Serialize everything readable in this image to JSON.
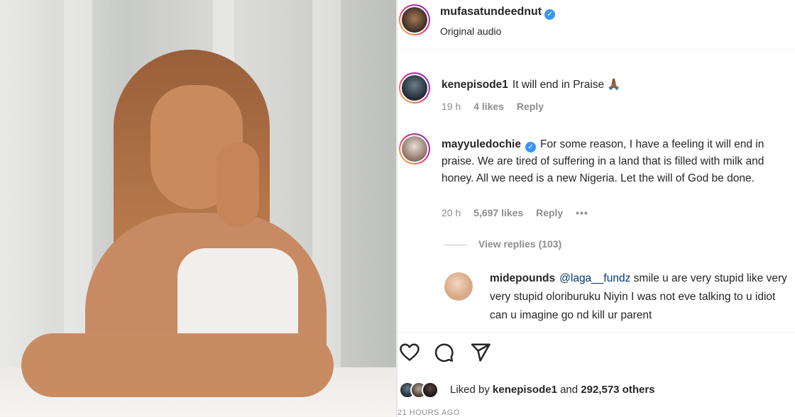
{
  "post": {
    "username": "mufasatundeednut",
    "subtitle": "Original audio"
  },
  "comments": [
    {
      "username": "kenepisode1",
      "text": "It will end in Praise 🙏🏾",
      "time": "19 h",
      "likes": "4 likes",
      "reply_label": "Reply"
    },
    {
      "username": "mayyuledochie",
      "text": "For some reason, I have a feeling it will end in praise. We are tired of suffering in a land that is filled with milk and honey. All we need is a new Nigeria. Let the will of God be done.",
      "time": "20 h",
      "likes": "5,697 likes",
      "reply_label": "Reply",
      "more": "•••"
    }
  ],
  "view_replies": "View replies (103)",
  "reply": {
    "username": "midepounds",
    "mention": "@laga__fundz",
    "text": "smile u are very stupid like very very stupid oloriburuku Niyin I was not eve talking to u idiot can u imagine go nd kill ur parent"
  },
  "liked_by": {
    "prefix": "Liked by",
    "user": "kenepisode1",
    "joiner": "and",
    "others": "292,573 others"
  },
  "timestamp": "21 HOURS AGO",
  "icons": [
    "heart-icon",
    "comment-icon",
    "share-icon",
    "verified-icon"
  ],
  "colors": {
    "verified": "#3897f0",
    "muted": "#8e8e8e",
    "mention": "#00376b"
  }
}
